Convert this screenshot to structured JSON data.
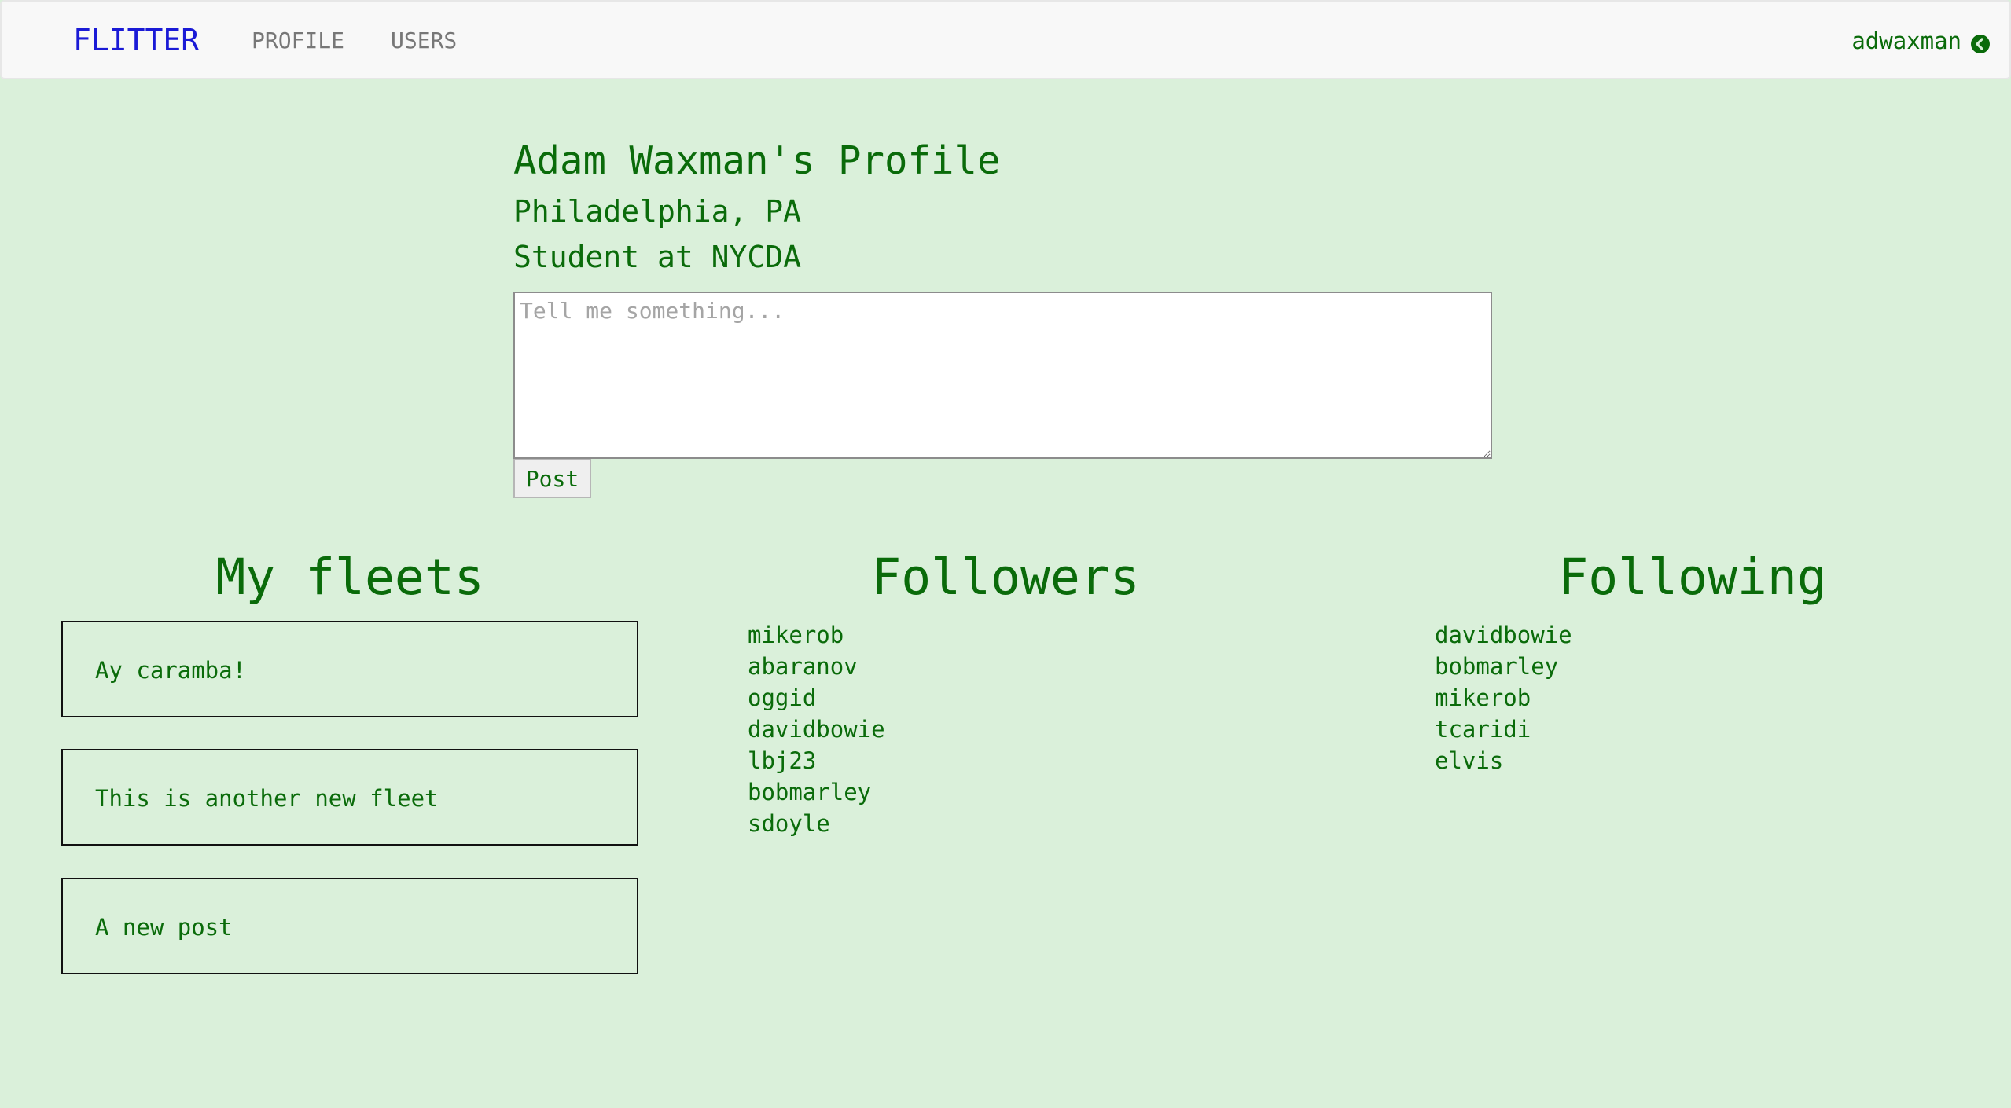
{
  "nav": {
    "brand": "FLITTER",
    "profile": "PROFILE",
    "users": "USERS",
    "username": "adwaxman"
  },
  "profile": {
    "title": "Adam Waxman's Profile",
    "location": "Philadelphia, PA",
    "occupation": "Student at NYCDA"
  },
  "composer": {
    "placeholder": "Tell me something...",
    "post_label": "Post"
  },
  "fleets": {
    "heading": "My fleets",
    "items": [
      "Ay caramba!",
      "This is another new fleet",
      "A new post"
    ]
  },
  "followers": {
    "heading": "Followers",
    "items": [
      "mikerob",
      "abaranov",
      "oggid",
      "davidbowie",
      "lbj23",
      "bobmarley",
      "sdoyle"
    ]
  },
  "following": {
    "heading": "Following",
    "items": [
      "davidbowie",
      "bobmarley",
      "mikerob",
      "tcaridi",
      "elvis"
    ]
  },
  "colors": {
    "page_background": "#daf0da",
    "text_green": "#0a6b0a",
    "brand_blue": "#1a1ad6"
  }
}
